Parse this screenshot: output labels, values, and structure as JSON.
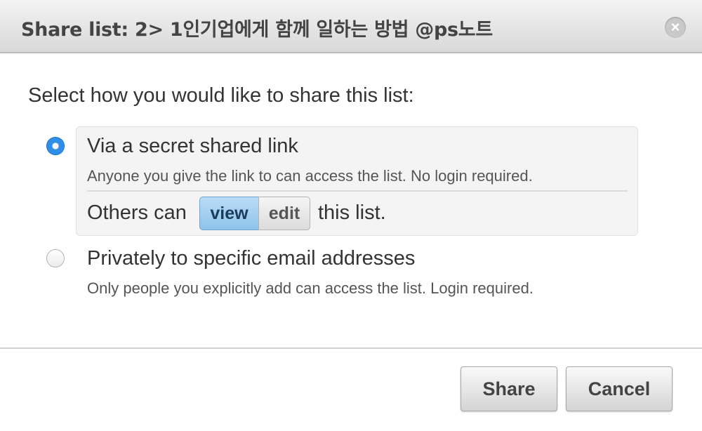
{
  "dialog": {
    "title": "Share list: 2> 1인기업에게 함께 일하는 방법 @ps노트",
    "close_icon": "×"
  },
  "prompt": "Select how you would like to share this list:",
  "options": [
    {
      "title": "Via a secret shared link",
      "description": "Anyone you give the link to can access the list. No login required.",
      "selected": true
    },
    {
      "title": "Privately to specific email addresses",
      "description": "Only people you explicitly add can access the list. Login required.",
      "selected": false
    }
  ],
  "permission": {
    "prefix": "Others can",
    "view_label": "view",
    "edit_label": "edit",
    "suffix": "this list.",
    "selected": "view"
  },
  "buttons": {
    "share": "Share",
    "cancel": "Cancel"
  },
  "colors": {
    "accent": "#2e8ee8",
    "selected_segment": "#9ccaee"
  }
}
